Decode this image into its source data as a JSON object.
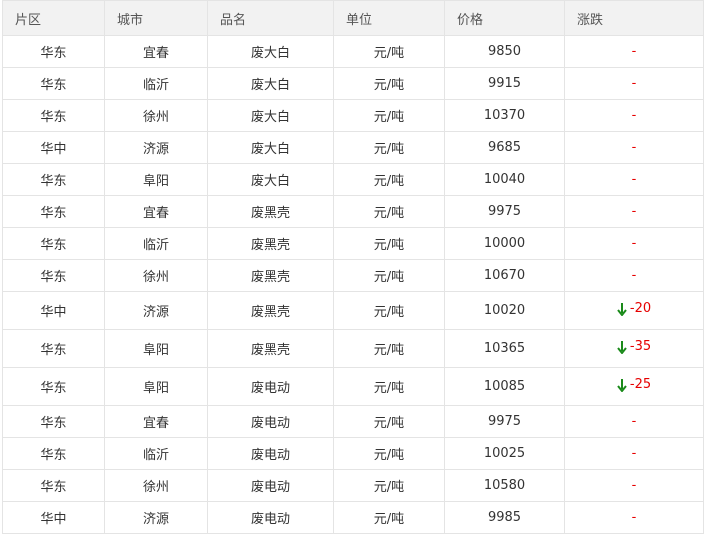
{
  "colors": {
    "header_bg": "#f2f2f2",
    "border": "#e4e4e4",
    "change_text": "#e60000",
    "down_arrow": "#1a8a1a"
  },
  "table": {
    "headers": [
      "片区",
      "城市",
      "品名",
      "单位",
      "价格",
      "涨跌"
    ],
    "rows": [
      {
        "region": "华东",
        "city": "宜春",
        "product": "废大白",
        "unit": "元/吨",
        "price": "9850",
        "change": "-",
        "down": false
      },
      {
        "region": "华东",
        "city": "临沂",
        "product": "废大白",
        "unit": "元/吨",
        "price": "9915",
        "change": "-",
        "down": false
      },
      {
        "region": "华东",
        "city": "徐州",
        "product": "废大白",
        "unit": "元/吨",
        "price": "10370",
        "change": "-",
        "down": false
      },
      {
        "region": "华中",
        "city": "济源",
        "product": "废大白",
        "unit": "元/吨",
        "price": "9685",
        "change": "-",
        "down": false
      },
      {
        "region": "华东",
        "city": "阜阳",
        "product": "废大白",
        "unit": "元/吨",
        "price": "10040",
        "change": "-",
        "down": false
      },
      {
        "region": "华东",
        "city": "宜春",
        "product": "废黑壳",
        "unit": "元/吨",
        "price": "9975",
        "change": "-",
        "down": false
      },
      {
        "region": "华东",
        "city": "临沂",
        "product": "废黑壳",
        "unit": "元/吨",
        "price": "10000",
        "change": "-",
        "down": false
      },
      {
        "region": "华东",
        "city": "徐州",
        "product": "废黑壳",
        "unit": "元/吨",
        "price": "10670",
        "change": "-",
        "down": false
      },
      {
        "region": "华中",
        "city": "济源",
        "product": "废黑壳",
        "unit": "元/吨",
        "price": "10020",
        "change": "-20",
        "down": true
      },
      {
        "region": "华东",
        "city": "阜阳",
        "product": "废黑壳",
        "unit": "元/吨",
        "price": "10365",
        "change": "-35",
        "down": true
      },
      {
        "region": "华东",
        "city": "阜阳",
        "product": "废电动",
        "unit": "元/吨",
        "price": "10085",
        "change": "-25",
        "down": true
      },
      {
        "region": "华东",
        "city": "宜春",
        "product": "废电动",
        "unit": "元/吨",
        "price": "9975",
        "change": "-",
        "down": false
      },
      {
        "region": "华东",
        "city": "临沂",
        "product": "废电动",
        "unit": "元/吨",
        "price": "10025",
        "change": "-",
        "down": false
      },
      {
        "region": "华东",
        "city": "徐州",
        "product": "废电动",
        "unit": "元/吨",
        "price": "10580",
        "change": "-",
        "down": false
      },
      {
        "region": "华中",
        "city": "济源",
        "product": "废电动",
        "unit": "元/吨",
        "price": "9985",
        "change": "-",
        "down": false
      }
    ]
  }
}
